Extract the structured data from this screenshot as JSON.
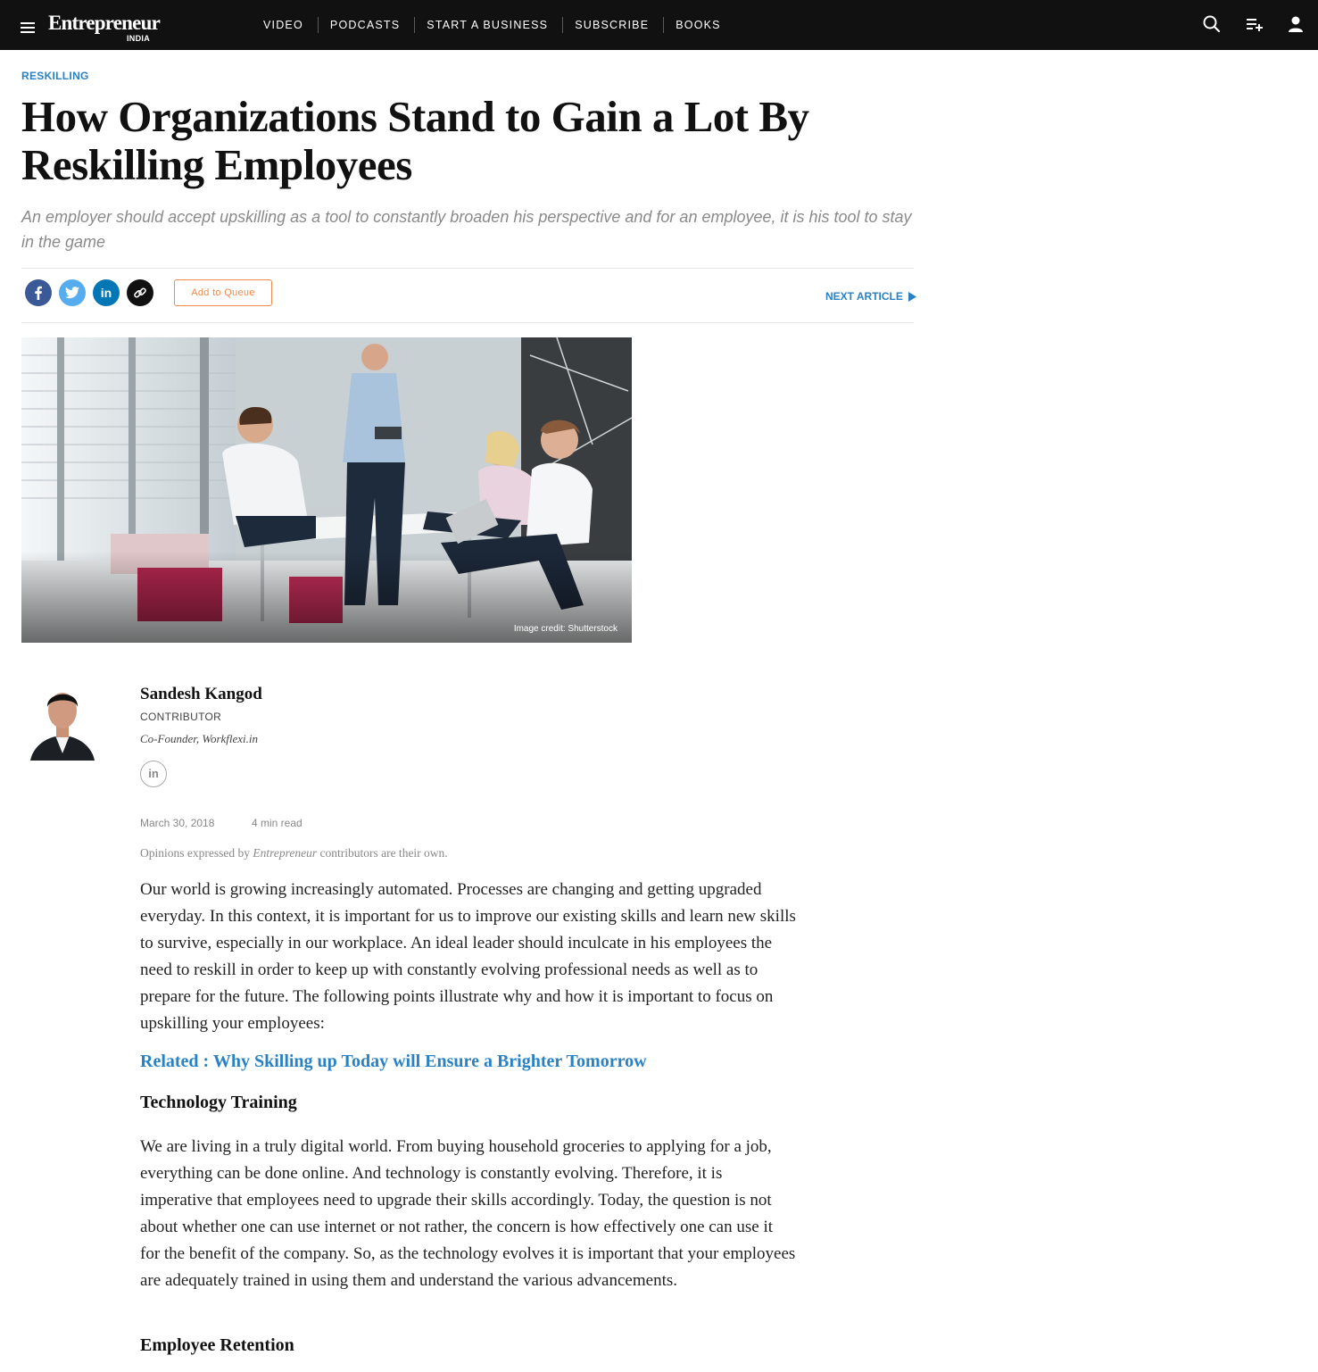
{
  "header": {
    "logo_main": "Entrepreneur",
    "logo_sub": "INDIA",
    "nav": [
      "VIDEO",
      "PODCASTS",
      "START A BUSINESS",
      "SUBSCRIBE",
      "BOOKS"
    ],
    "icons": [
      "menu-icon",
      "search-icon",
      "queue-add-icon",
      "user-icon"
    ]
  },
  "article": {
    "category": "RESKILLING",
    "title": "How Organizations Stand to Gain a Lot By Reskilling Employees",
    "subtitle": "An employer should accept upskilling as a tool to constantly broaden his perspective and for an employee, it is his tool to stay in the game",
    "share_icons": [
      "facebook-icon",
      "twitter-icon",
      "linkedin-icon",
      "link-icon"
    ],
    "add_to_queue": "Add to Queue",
    "next_article": "NEXT ARTICLE",
    "image_credit": "Image credit: Shutterstock"
  },
  "author": {
    "name": "Sandesh Kangod",
    "role": "CONTRIBUTOR",
    "bio": "Co-Founder, Workflexi.in",
    "linkedin_label": "in"
  },
  "meta": {
    "date": "March 30, 2018",
    "read_time": "4 min read",
    "disclaimer_prefix": "Opinions expressed by ",
    "disclaimer_brand": "Entrepreneur",
    "disclaimer_suffix": " contributors are their own."
  },
  "body": {
    "para1": "Our world is growing increasingly automated. Processes are changing and getting upgraded everyday. In this context, it is important for us to improve our existing skills and learn new skills to survive, especially in our workplace. An ideal leader should inculcate in his employees the need to reskill in order to keep up with constantly evolving professional needs as well as to prepare for the future. The following points illustrate why and how it is important to focus on upskilling your employees:",
    "related": "Related : Why Skilling up Today will Ensure a Brighter Tomorrow",
    "heading1": "Technology Training",
    "para2": "We are living in a truly digital world. From buying household groceries to applying for a job, everything can be done online. And technology is constantly evolving. Therefore, it is imperative that employees need to upgrade their skills accordingly. Today, the question is not about whether one can use internet or not rather, the concern is how effectively one can use it for the benefit of the company. So, as the technology evolves it is important that your employees are adequately trained in using them and understand the various advancements.",
    "heading2": "Employee Retention"
  },
  "colors": {
    "topbar": "#111111",
    "accent_blue": "#2a82c4",
    "queue_orange": "#f08a4b",
    "facebook": "#3b5998",
    "twitter": "#55acee",
    "linkedin": "#0077b5"
  }
}
